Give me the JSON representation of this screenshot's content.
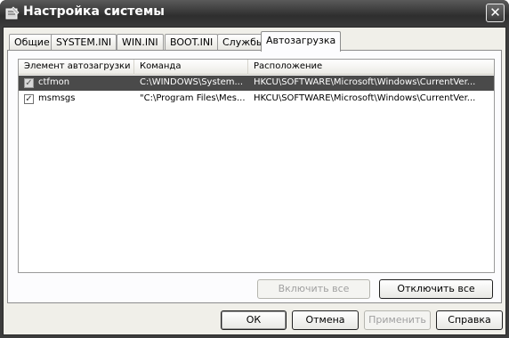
{
  "window": {
    "title": "Настройка системы",
    "close_glyph": "✕"
  },
  "tabs": [
    {
      "label": "Общие",
      "active": false
    },
    {
      "label": "SYSTEM.INI",
      "active": false
    },
    {
      "label": "WIN.INI",
      "active": false
    },
    {
      "label": "BOOT.INI",
      "active": false
    },
    {
      "label": "Службы",
      "active": false
    },
    {
      "label": "Автозагрузка",
      "active": true
    }
  ],
  "startup_list": {
    "columns": [
      "Элемент автозагрузки",
      "Команда",
      "Расположение"
    ],
    "rows": [
      {
        "checked": true,
        "selected": true,
        "item": "ctfmon",
        "command": "C:\\WINDOWS\\System...",
        "location": "HKCU\\SOFTWARE\\Microsoft\\Windows\\CurrentVer..."
      },
      {
        "checked": true,
        "selected": false,
        "item": "msmsgs",
        "command": "\"C:\\Program Files\\Mes...",
        "location": "HKCU\\SOFTWARE\\Microsoft\\Windows\\CurrentVer..."
      }
    ]
  },
  "panel_buttons": {
    "enable_all": "Включить все",
    "disable_all": "Отключить все"
  },
  "dialog_buttons": {
    "ok": "ОК",
    "cancel": "Отмена",
    "apply": "Применить",
    "help": "Справка"
  }
}
